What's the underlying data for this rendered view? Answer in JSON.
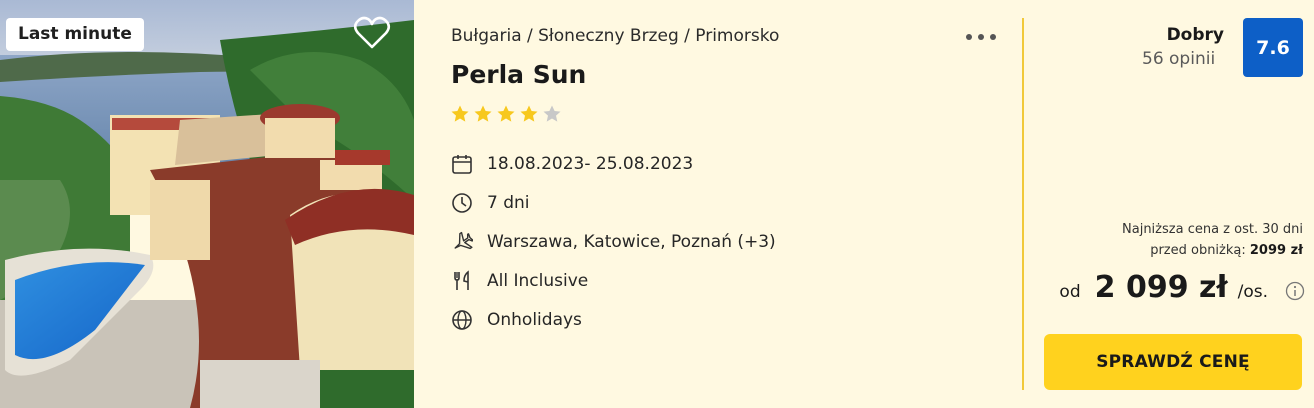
{
  "badge": "Last minute",
  "breadcrumb": "Bułgaria / Słoneczny Brzeg / Primorsko",
  "hotel_name": "Perla Sun",
  "stars": {
    "filled": 4,
    "total": 5
  },
  "details": {
    "dates": "18.08.2023- 25.08.2023",
    "duration": "7 dni",
    "departure": "Warszawa, Katowice, Poznań  (+3)",
    "board": "All Inclusive",
    "operator": "Onholidays"
  },
  "rating": {
    "label": "Dobry",
    "count": "56 opinii",
    "score": "7.6"
  },
  "price": {
    "lowest_line1": "Najniższa cena z ost. 30 dni",
    "lowest_line2": "przed obniżką:",
    "lowest_value": "2099 zł",
    "from": "od",
    "amount": "2 099 zł",
    "per": "/os."
  },
  "cta_label": "SPRAWDŹ CENĘ",
  "colors": {
    "background": "#fff9e1",
    "accent_yellow": "#ffd21e",
    "divider": "#f1c93a",
    "score_blue": "#0d5fc7",
    "star": "#f7c81e",
    "star_empty": "#c8c8c8"
  },
  "icons": {
    "favorite": "heart-icon",
    "more": "more-dots-icon",
    "dates": "calendar-icon",
    "duration": "clock-icon",
    "departure": "plane-icon",
    "board": "cutlery-icon",
    "operator": "globe-icon",
    "price_info": "info-icon"
  }
}
